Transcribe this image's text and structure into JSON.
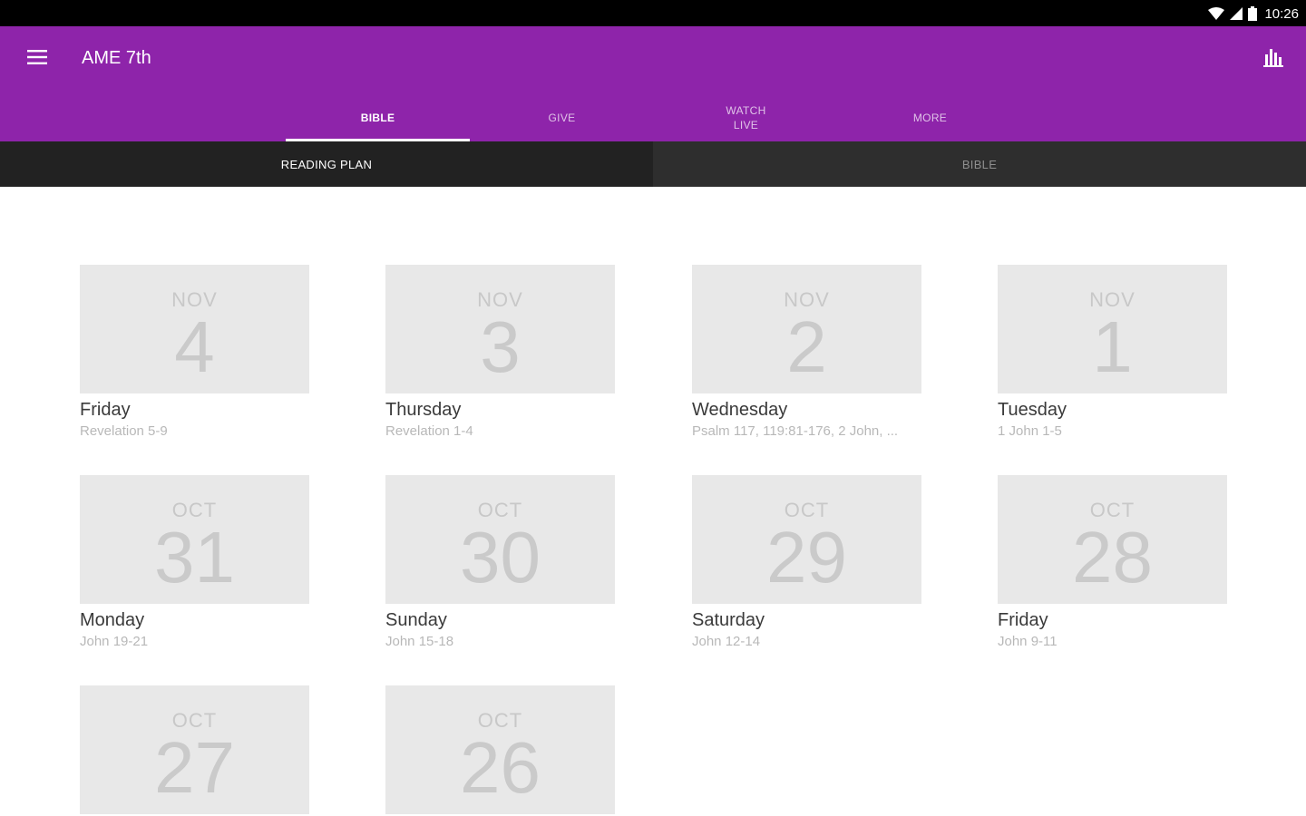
{
  "status_bar": {
    "time": "10:26",
    "icons": [
      "wifi-icon",
      "signal-icon",
      "battery-icon"
    ]
  },
  "app_bar": {
    "menu_icon": "hamburger-menu-icon",
    "title": "AME 7th",
    "action_icon": "bar-chart-icon",
    "color": "#8e24aa"
  },
  "tabs": [
    {
      "label": "BIBLE",
      "active": true
    },
    {
      "label": "GIVE",
      "active": false
    },
    {
      "label": "WATCH\nLIVE",
      "active": false
    },
    {
      "label": "MORE",
      "active": false
    }
  ],
  "subtabs": [
    {
      "label": "READING PLAN",
      "active": true
    },
    {
      "label": "BIBLE",
      "active": false
    }
  ],
  "readings": [
    {
      "month": "NOV",
      "day": "4",
      "weekday": "Friday",
      "passage": "Revelation 5-9"
    },
    {
      "month": "NOV",
      "day": "3",
      "weekday": "Thursday",
      "passage": "Revelation 1-4"
    },
    {
      "month": "NOV",
      "day": "2",
      "weekday": "Wednesday",
      "passage": "Psalm 117, 119:81-176, 2 John, ..."
    },
    {
      "month": "NOV",
      "day": "1",
      "weekday": "Tuesday",
      "passage": "1 John 1-5"
    },
    {
      "month": "OCT",
      "day": "31",
      "weekday": "Monday",
      "passage": "John 19-21"
    },
    {
      "month": "OCT",
      "day": "30",
      "weekday": "Sunday",
      "passage": "John 15-18"
    },
    {
      "month": "OCT",
      "day": "29",
      "weekday": "Saturday",
      "passage": "John 12-14"
    },
    {
      "month": "OCT",
      "day": "28",
      "weekday": "Friday",
      "passage": "John 9-11"
    },
    {
      "month": "OCT",
      "day": "27",
      "weekday": "",
      "passage": ""
    },
    {
      "month": "OCT",
      "day": "26",
      "weekday": "",
      "passage": ""
    }
  ]
}
